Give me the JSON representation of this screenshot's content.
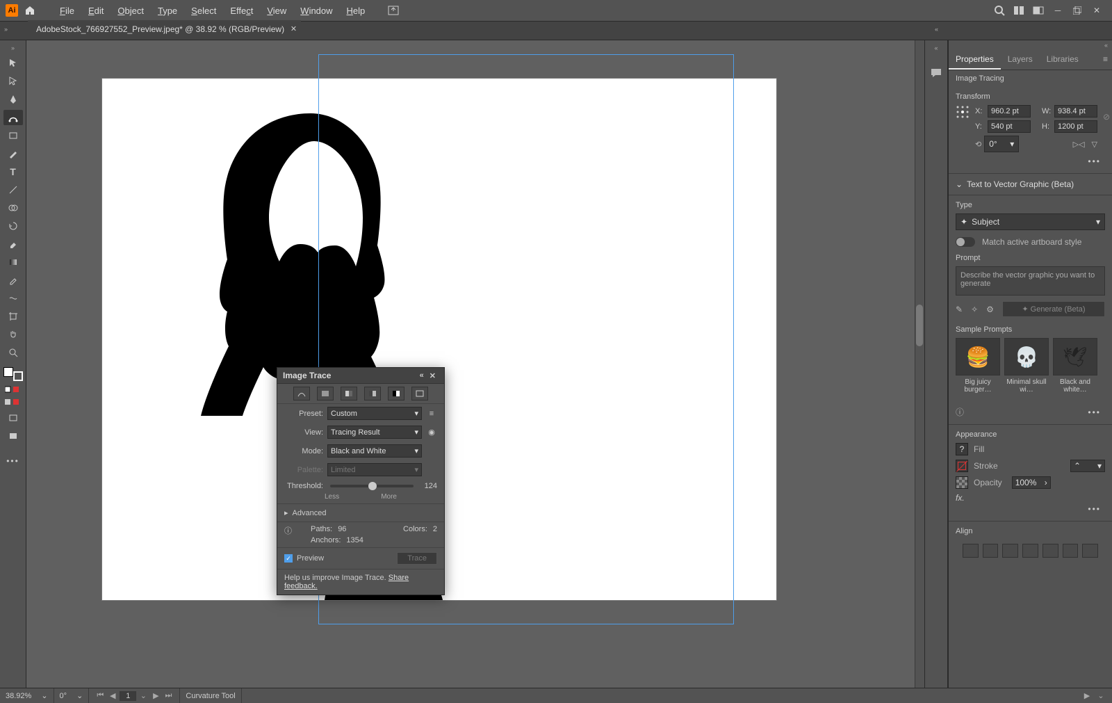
{
  "menubar": {
    "logo": "Ai",
    "items": [
      "File",
      "Edit",
      "Object",
      "Type",
      "Select",
      "Effect",
      "View",
      "Window",
      "Help"
    ]
  },
  "tab": {
    "title": "AdobeStock_766927552_Preview.jpeg* @ 38.92 % (RGB/Preview)"
  },
  "right": {
    "tabs": [
      "Properties",
      "Layers",
      "Libraries"
    ],
    "imagetracing": "Image Tracing",
    "transform": {
      "title": "Transform",
      "x": "960.2 pt",
      "y": "540 pt",
      "w": "938.4 pt",
      "h": "1200 pt",
      "angle": "0°"
    },
    "t2v": {
      "header": "Text to Vector Graphic (Beta)",
      "type_label": "Type",
      "type_value": "Subject",
      "match_label": "Match active artboard style",
      "prompt_label": "Prompt",
      "prompt_placeholder": "Describe the vector graphic you want to generate",
      "generate": "Generate (Beta)",
      "sample_title": "Sample Prompts",
      "samples": [
        "Big juicy burger…",
        "Minimal skull wi…",
        "Black and white…"
      ]
    },
    "appearance": {
      "title": "Appearance",
      "fill": "Fill",
      "stroke": "Stroke",
      "opacity_label": "Opacity",
      "opacity_value": "100%"
    },
    "align": "Align"
  },
  "imagetrace": {
    "title": "Image Trace",
    "preset_label": "Preset:",
    "preset_value": "Custom",
    "view_label": "View:",
    "view_value": "Tracing Result",
    "mode_label": "Mode:",
    "mode_value": "Black and White",
    "palette_label": "Palette:",
    "palette_value": "Limited",
    "threshold_label": "Threshold:",
    "threshold_value": "124",
    "less": "Less",
    "more": "More",
    "advanced": "Advanced",
    "paths_label": "Paths:",
    "paths_value": "96",
    "colors_label": "Colors:",
    "colors_value": "2",
    "anchors_label": "Anchors:",
    "anchors_value": "1354",
    "preview": "Preview",
    "trace": "Trace",
    "help": "Help us improve Image Trace.",
    "feedback": "Share feedback."
  },
  "status": {
    "zoom": "38.92%",
    "rotate": "0°",
    "artboard": "1",
    "tool": "Curvature Tool"
  }
}
